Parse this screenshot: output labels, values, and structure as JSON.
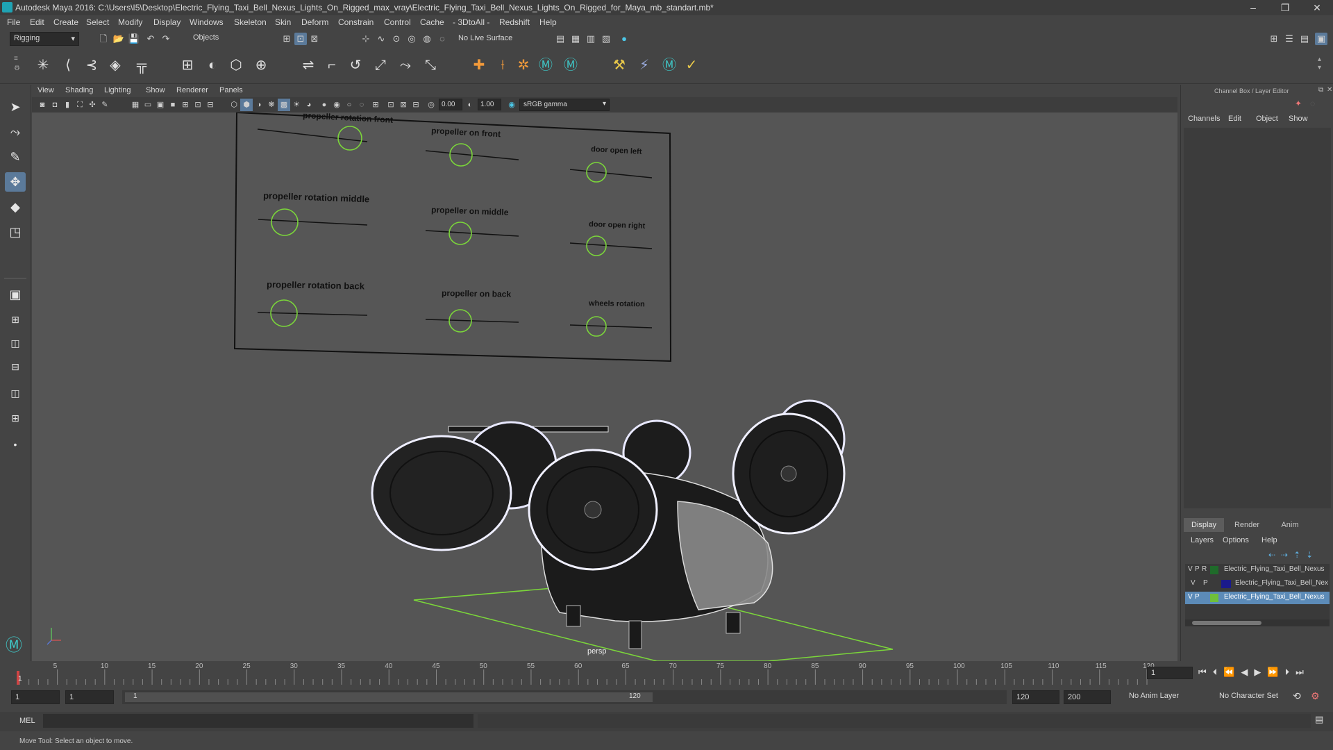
{
  "window": {
    "title": "Autodesk Maya 2016: C:\\Users\\I5\\Desktop\\Electric_Flying_Taxi_Bell_Nexus_Lights_On_Rigged_max_vray\\Electric_Flying_Taxi_Bell_Nexus_Lights_On_Rigged_for_Maya_mb_standart.mb*",
    "minimize": "–",
    "maximize": "❐",
    "close": "✕"
  },
  "menubar": [
    "File",
    "Edit",
    "Create",
    "Select",
    "Modify",
    "Display",
    "Windows",
    "Skeleton",
    "Skin",
    "Deform",
    "Constrain",
    "Control",
    "Cache",
    "- 3DtoAll -",
    "Redshift",
    "Help"
  ],
  "statusline": {
    "mode": "Rigging",
    "selection_mode": "Objects",
    "live_surface": "No Live Surface"
  },
  "panel_menu": [
    "View",
    "Shading",
    "Lighting",
    "Show",
    "Renderer",
    "Panels"
  ],
  "view_toolbar": {
    "exposure": "0.00",
    "gamma": "1.00",
    "color_space": "sRGB gamma"
  },
  "viewport": {
    "camera_label": "persp",
    "control_board": {
      "labels": [
        "propeller rotation front",
        "propeller on front",
        "door open left",
        "propeller rotation middle",
        "propeller on middle",
        "door open right",
        "propeller rotation back",
        "propeller on back",
        "wheels rotation"
      ]
    }
  },
  "channel_box": {
    "header": "Channel Box / Layer Editor",
    "menu": [
      "Channels",
      "Edit",
      "Object",
      "Show"
    ],
    "tabs": [
      "Display",
      "Render",
      "Anim"
    ],
    "active_tab": "Display",
    "layer_menu": [
      "Layers",
      "Options",
      "Help"
    ],
    "layers": [
      {
        "v": "V",
        "p": "P",
        "r": "R",
        "color": "#1f6b2a",
        "name": "Electric_Flying_Taxi_Bell_Nexus",
        "selected": false
      },
      {
        "v": "V",
        "p": "P",
        "r": "",
        "color": "#1a1a8c",
        "name": "Electric_Flying_Taxi_Bell_Nexus",
        "selected": false
      },
      {
        "v": "V",
        "p": "P",
        "r": "",
        "color": "#6fbf3a",
        "name": "Electric_Flying_Taxi_Bell_Nexus",
        "selected": true
      }
    ]
  },
  "timeline": {
    "ticks": [
      "5",
      "10",
      "15",
      "20",
      "25",
      "30",
      "35",
      "40",
      "45",
      "50",
      "55",
      "60",
      "65",
      "70",
      "75",
      "80",
      "85",
      "90",
      "95",
      "100",
      "105",
      "110",
      "115",
      "120"
    ],
    "first_frame": "1",
    "current_frame": "1"
  },
  "range": {
    "start": "1",
    "playback_start": "1",
    "slider_start": "1",
    "slider_end": "120",
    "playback_end": "120",
    "end": "200",
    "anim_layer": "No Anim Layer",
    "character_set": "No Character Set"
  },
  "cmdline": {
    "label": "MEL"
  },
  "helpline": {
    "text": "Move Tool: Select an object to move."
  }
}
